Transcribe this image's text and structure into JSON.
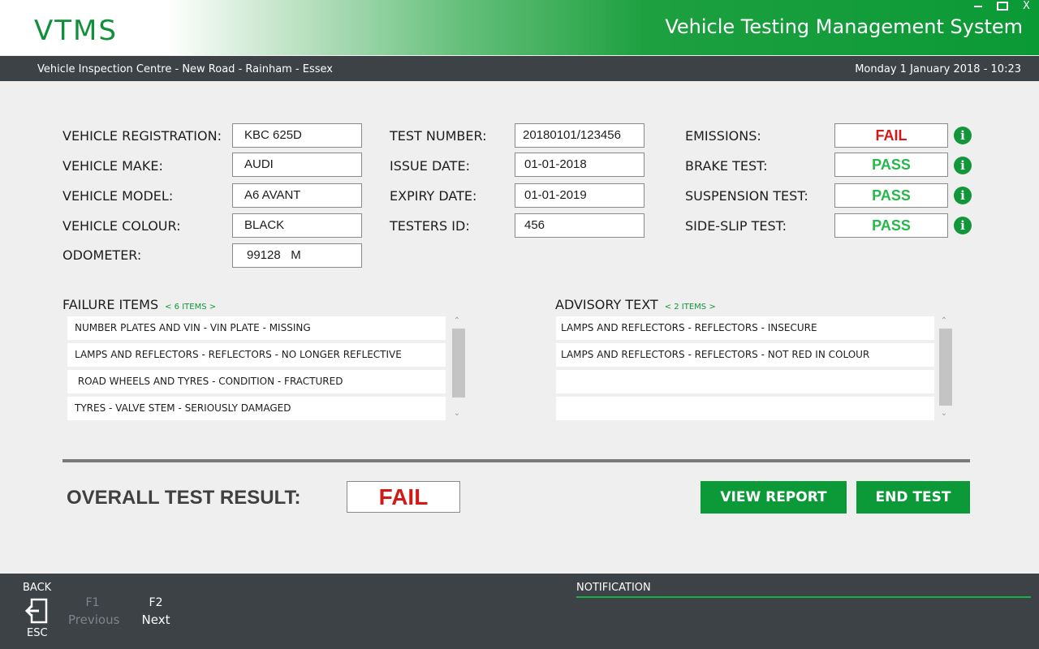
{
  "header": {
    "logo": "VTMS",
    "title": "Vehicle Testing Management System",
    "window_close": "X"
  },
  "subbar": {
    "location": "Vehicle Inspection Centre - New Road - Rainham - Essex",
    "datetime": "Monday 1 January 2018 - 10:23"
  },
  "vehicle": {
    "registration_label": "VEHICLE REGISTRATION:",
    "registration": "KBC 625D",
    "make_label": "VEHICLE MAKE:",
    "make": "AUDI",
    "model_label": "VEHICLE MODEL:",
    "model": "A6 AVANT",
    "colour_label": "VEHICLE COLOUR:",
    "colour": "BLACK",
    "odometer_label": "ODOMETER:",
    "odometer": "99128   M"
  },
  "test": {
    "number_label": "TEST NUMBER:",
    "number": "20180101/123456",
    "issue_label": "ISSUE DATE:",
    "issue": "01-01-2018",
    "expiry_label": "EXPIRY DATE:",
    "expiry": "01-01-2019",
    "tester_label": "TESTERS ID:",
    "tester": "456"
  },
  "results": [
    {
      "label": "EMISSIONS:",
      "value": "FAIL",
      "status": "fail"
    },
    {
      "label": "BRAKE TEST:",
      "value": "PASS",
      "status": "pass"
    },
    {
      "label": "SUSPENSION TEST:",
      "value": "PASS",
      "status": "pass"
    },
    {
      "label": "SIDE-SLIP TEST:",
      "value": "PASS",
      "status": "pass"
    }
  ],
  "info_icon_glyph": "i",
  "failures": {
    "title": "FAILURE ITEMS",
    "count": "< 6 ITEMS >",
    "items": [
      "NUMBER PLATES AND VIN - VIN PLATE - MISSING",
      "LAMPS AND REFLECTORS - REFLECTORS - NO LONGER REFLECTIVE",
      " ROAD WHEELS AND TYRES - CONDITION - FRACTURED",
      "TYRES - VALVE STEM - SERIOUSLY DAMAGED"
    ]
  },
  "advisory": {
    "title": "ADVISORY TEXT",
    "count": "< 2 ITEMS >",
    "items": [
      "LAMPS AND REFLECTORS - REFLECTORS - INSECURE",
      "LAMPS AND REFLECTORS - REFLECTORS - NOT RED IN COLOUR",
      "",
      ""
    ]
  },
  "overall": {
    "label": "OVERALL TEST RESULT:",
    "value": "FAIL"
  },
  "buttons": {
    "view_report": "VIEW REPORT",
    "end_test": "END TEST"
  },
  "footer": {
    "back": "BACK",
    "esc": "ESC",
    "f1_key": "F1",
    "f1_action": "Previous",
    "f2_key": "F2",
    "f2_action": "Next",
    "notification": "NOTIFICATION"
  },
  "colors": {
    "brand_green": "#0b9a37",
    "pass": "#25b84b",
    "fail": "#d31818",
    "bar_dark": "#3d4246"
  }
}
